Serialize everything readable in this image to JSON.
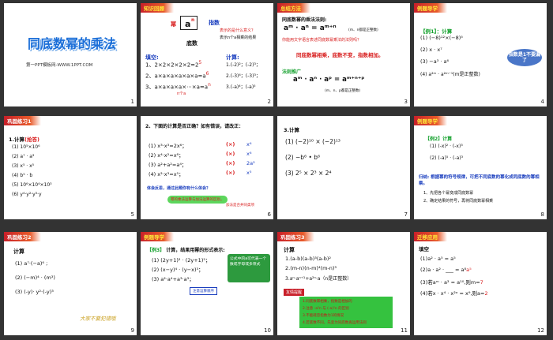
{
  "slides": [
    {
      "num": "1",
      "title": "同底数幂的乘法",
      "footer": "第一PPT模板网-WWW.1PPT.COM"
    },
    {
      "num": "2",
      "ribbon": "知识回顾",
      "base_label": "幂",
      "exp_label": "指数",
      "base_word": "底数",
      "power": "a",
      "power_sup": "n",
      "question1": "表示的是什么意义？",
      "question2": "表示n个a相乘的结果",
      "fill_label": "填空:",
      "items": [
        "1、2×2×2×2×2=2",
        "2、a×a×a×a×a×a=a",
        "3、a×a×a×a×···×a=a"
      ],
      "item_ans": [
        "5",
        "6",
        "n"
      ],
      "n_note": "n个a",
      "calc_label": "计算:",
      "calc": [
        "1.(-2)²；(-2)³；",
        "2.(-3)⁴；(-3)³；",
        "3.(-a)⁴；(-a)⁵"
      ]
    },
    {
      "num": "3",
      "ribbon": "总结方法",
      "rule_title": "同底数幂的乘法法则:",
      "formula": "aᵐ · aⁿ = aᵐ⁺ⁿ",
      "cond": "(m、n都是正整数)",
      "question": "你能用文字语言表述同底数幂乘法的法则吗？",
      "rule_text": "同底数幂相乘，底数不变，指数相加。",
      "ext_label": "法则推广",
      "ext_formula": "aᵐ · aⁿ · aᵖ = aᵐ⁺ⁿ⁺ᵖ",
      "ext_cond": "(m、n、p都是正整数)"
    },
    {
      "num": "4",
      "ribbon": "例题导学",
      "ex_label": "【例1】：计算",
      "items": [
        "(1)  (−8)¹²×(−8)⁵",
        "(2)  x · x⁷",
        "(3)  −a³ · a⁶",
        "(4)  a²ᵐ · a²ᵐ⁻¹(m是正整数)"
      ],
      "bubble": "指数是1不要漏了"
    },
    {
      "num": "5",
      "ribbon": "巩固练习1",
      "calc_label": "1.计算",
      "calc_note": "(抢答)",
      "items": [
        "(1)  10⁵×10⁶",
        "(2)  a⁷ · a³",
        "(3)  x⁵ · x⁵",
        "(4)  b⁵ · b",
        "(5)  10⁶×10⁴×10³",
        "(6)  y⁴·y²·y³·y"
      ]
    },
    {
      "num": "6",
      "question": "2、下面的计算是否正确？如有错误，请改正：",
      "items": [
        "(1) x³·x³=2x⁶；",
        "(2) x⁴·x²=x⁸；",
        "(3) a²+a²=a⁴；",
        "(4) x²·x³=x⁵；"
      ],
      "marks": [
        "(×)",
        "(×)",
        "(×)",
        "(×)"
      ],
      "answers": [
        "x⁶",
        "x⁶",
        "2a²",
        "x⁵"
      ],
      "reflect": "体会反思，通过此题你有什么体会？",
      "bubble_left": "幂的乘法运算与加法运算的区别，",
      "bubble_right": "加法是合并同类项"
    },
    {
      "num": "7",
      "calc_label": "3.计算",
      "items": [
        "(1) (−2)¹⁰ × (−2)¹³",
        "(2) −b⁶ • b⁶",
        "(3) 2⁵ × 2³ × 2⁴"
      ]
    },
    {
      "num": "8",
      "ribbon": "例题导学",
      "ex_label": "【例2】计算",
      "items": [
        "(1)   (-x)² · (-x)³",
        "(2)   (-a)⁵ · (-a)³"
      ],
      "summary": "归纳: 根据幂的符号规律，可把不同底数的幂化成同底数的幂相乘。",
      "steps": [
        "1、先把各个幂变成同底数幂",
        "2、确定结果的符号，再将同底数幂相乘"
      ]
    },
    {
      "num": "9",
      "ribbon": "巩固练习2",
      "calc_label": "计算",
      "items": [
        "(1)    a⁷·(−a)⁶ ;",
        "(2)    (−m)⁴ · (m³)",
        "(3)    (-y)· y²·(-y)³"
      ],
      "footer_word": "大家不要犯错哦"
    },
    {
      "num": "10",
      "ribbon": "例题导学",
      "ex_label": "【例3】",
      "ex_text": "计算，结果用幂的形式表示:",
      "items": [
        "(1) (2y+1)² · (2y+1)⁵；",
        "(2) (x−y)⁴ · (y−x)³；",
        "(3) a²·a⁴+a³·a³；"
      ],
      "bubble": "公式中的a可代表一个数或字母或多项式",
      "note": "注意运算顺序"
    },
    {
      "num": "11",
      "ribbon": "巩固练习3",
      "calc_label": "计算",
      "items": [
        "1.(a-b)(a-b)³(a-b)²",
        "2.(m-n)(n-m)⁴(m-n)³",
        "3.aⁿ·aⁿ⁺¹+a²ⁿ·a（n是正整数）"
      ],
      "tip_label": "友情提醒",
      "tips": [
        "1.同底数幂相乘，指数是相加的",
        "2.注意 -a²n 与 (-a)²n 的区别",
        "3.不能疏忽指数为1的情况",
        "4.若底数不同，先变为同底数再运用法则"
      ]
    },
    {
      "num": "12",
      "ribbon": "迁移应用",
      "fill_label": "填空",
      "items": [
        "(1)a² · a⁵ = a⁵",
        "(2)a · a² · ___ = a⁸",
        "(3)若aᵐ · a³ = a¹⁰,则m=",
        "(4)若x · x⁴ · x²ᵃ = x⁹,则a="
      ],
      "answers": [
        "",
        "a⁵",
        "7",
        "2"
      ]
    }
  ]
}
